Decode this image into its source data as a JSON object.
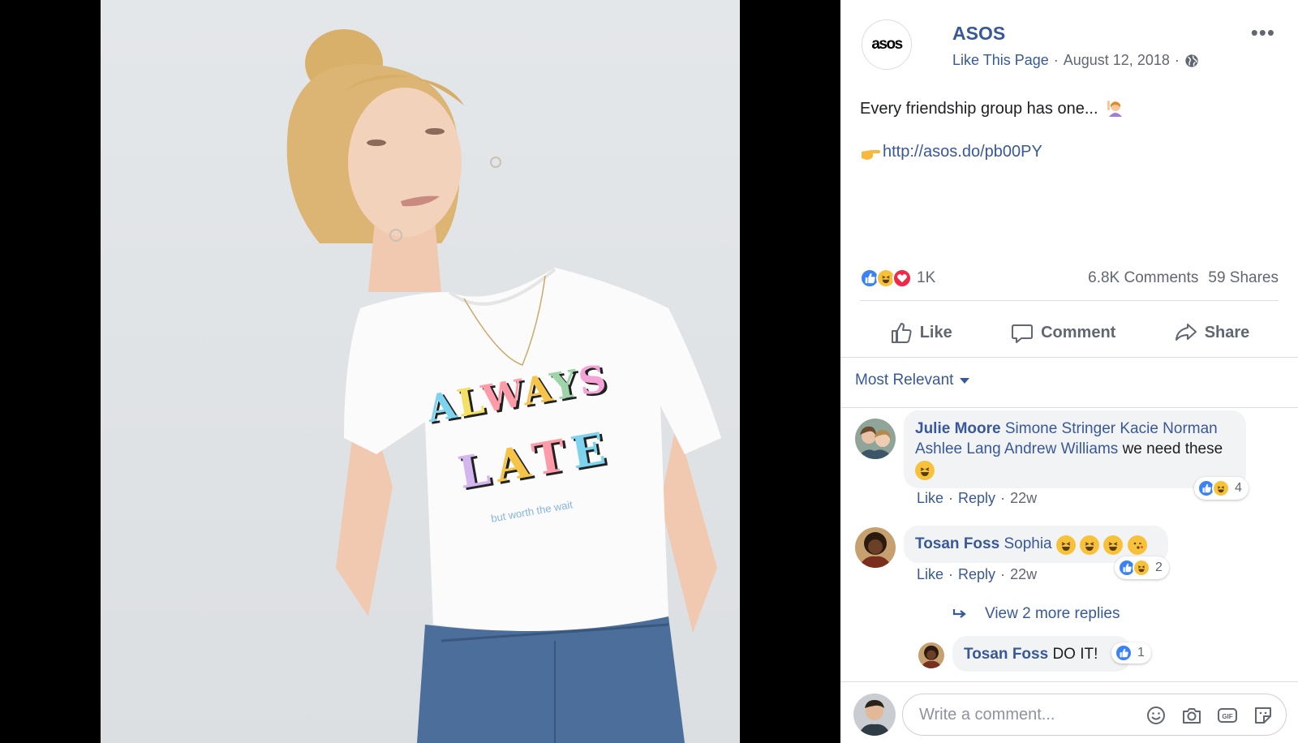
{
  "shirt": {
    "line1": "ALWAYS",
    "line2": "LATE",
    "line3": "but worth the wait"
  },
  "post": {
    "page_name": "ASOS",
    "avatar_text": "asos",
    "like_page": "Like This Page",
    "separator": "·",
    "date": "August 12, 2018",
    "text": "Every friendship group has one...",
    "link": "http://asos.do/pb00PY",
    "reaction_count": "1K",
    "comments_count": "6.8K Comments",
    "shares_count": "59 Shares"
  },
  "actions": {
    "like": "Like",
    "comment": "Comment",
    "share": "Share"
  },
  "sort_label": "Most Relevant",
  "comments": [
    {
      "author": "Julie Moore",
      "tags": "Simone Stringer Kacie Norman Ashlee Lang Andrew Williams",
      "text": "we need these",
      "like": "Like",
      "reply": "Reply",
      "time": "22w",
      "reactions": "4"
    },
    {
      "author": "Tosan Foss",
      "tags": "Sophia",
      "text": "",
      "like": "Like",
      "reply": "Reply",
      "time": "22w",
      "reactions": "2"
    }
  ],
  "view_more_replies": "View 2 more replies",
  "reply": {
    "author": "Tosan Foss",
    "text": "DO IT!",
    "reactions": "1"
  },
  "composer": {
    "placeholder": "Write a comment..."
  },
  "colors": {
    "link_blue": "#385898",
    "like_blue": "#3b82f6",
    "love_red": "#f0284a",
    "haha_yellow": "#f7c23a",
    "muted": "#606770"
  }
}
